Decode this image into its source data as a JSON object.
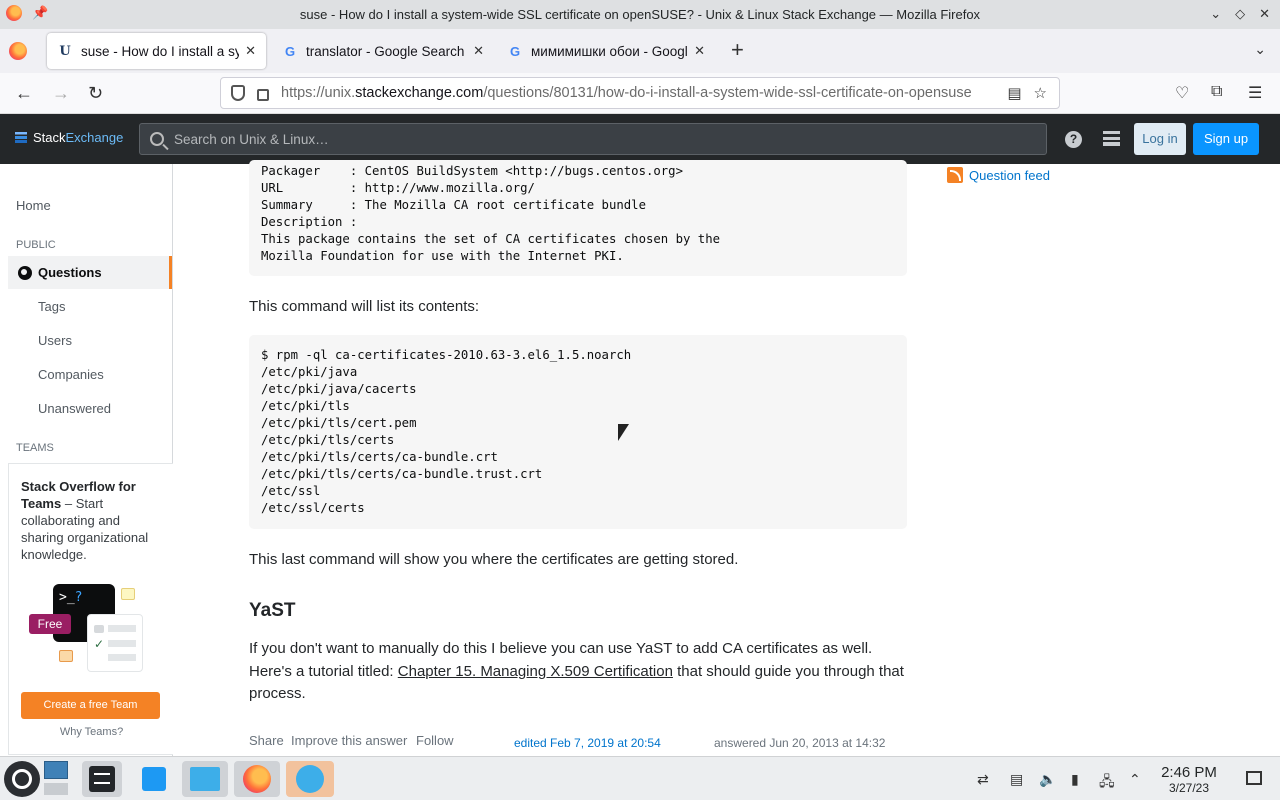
{
  "window": {
    "title": "suse - How do I install a system-wide SSL certificate on openSUSE? - Unix & Linux Stack Exchange — Mozilla Firefox"
  },
  "tabs": [
    {
      "title": "suse - How do I install a system-wide SSL certificate on openSUSE?",
      "favicon": "U"
    },
    {
      "title": "translator - Google Search",
      "favicon": "G"
    },
    {
      "title": "мимимишки обои - Google Search",
      "favicon": "G"
    }
  ],
  "address": {
    "prefix": "https://unix.",
    "domain": "stackexchange.com",
    "path": "/questions/80131/how-do-i-install-a-system-wide-ssl-certificate-on-opensuse"
  },
  "se": {
    "logo_a": "Stack",
    "logo_b": "Exchange",
    "search_placeholder": "Search on Unix & Linux…",
    "help": "?",
    "login": "Log in",
    "signup": "Sign up"
  },
  "leftnav": {
    "home": "Home",
    "public": "PUBLIC",
    "questions": "Questions",
    "tags": "Tags",
    "users": "Users",
    "companies": "Companies",
    "unanswered": "Unanswered",
    "teams": "TEAMS",
    "teams_title": "Stack Overflow for Teams",
    "teams_text": " – Start collaborating and sharing organizational knowledge.",
    "free_badge": "Free",
    "create_team": "Create a free Team",
    "why_teams": "Why Teams?"
  },
  "content": {
    "code1": "Packager    : CentOS BuildSystem <http://bugs.centos.org>\nURL         : http://www.mozilla.org/\nSummary     : The Mozilla CA root certificate bundle\nDescription :\nThis package contains the set of CA certificates chosen by the\nMozilla Foundation for use with the Internet PKI.",
    "p1": "This command will list its contents:",
    "code2": "$ rpm -ql ca-certificates-2010.63-3.el6_1.5.noarch\n/etc/pki/java\n/etc/pki/java/cacerts\n/etc/pki/tls\n/etc/pki/tls/cert.pem\n/etc/pki/tls/certs\n/etc/pki/tls/certs/ca-bundle.crt\n/etc/pki/tls/certs/ca-bundle.trust.crt\n/etc/ssl\n/etc/ssl/certs",
    "p2": "This last command will show you where the certificates are getting stored.",
    "h2": "YaST",
    "p3_a": "If you don't want to manually do this I believe you can use YaST to add CA certificates as well. Here's a tutorial titled: ",
    "p3_link": "Chapter 15. Managing X.509 Certification",
    "p3_b": " that should guide you through that process.",
    "share": "Share",
    "improve": "Improve this answer",
    "follow": "Follow",
    "edited": "edited Feb 7, 2019 at 20:54",
    "answered": "answered Jun 20, 2013 at 14:32"
  },
  "sidebar": {
    "feed": "Question feed"
  },
  "clock": {
    "time": "2:46 PM",
    "date": "3/27/23"
  },
  "colors": {
    "se_top": "#242729",
    "accent": "#f48225",
    "link": "#0074cc",
    "signup": "#0a95ff"
  }
}
